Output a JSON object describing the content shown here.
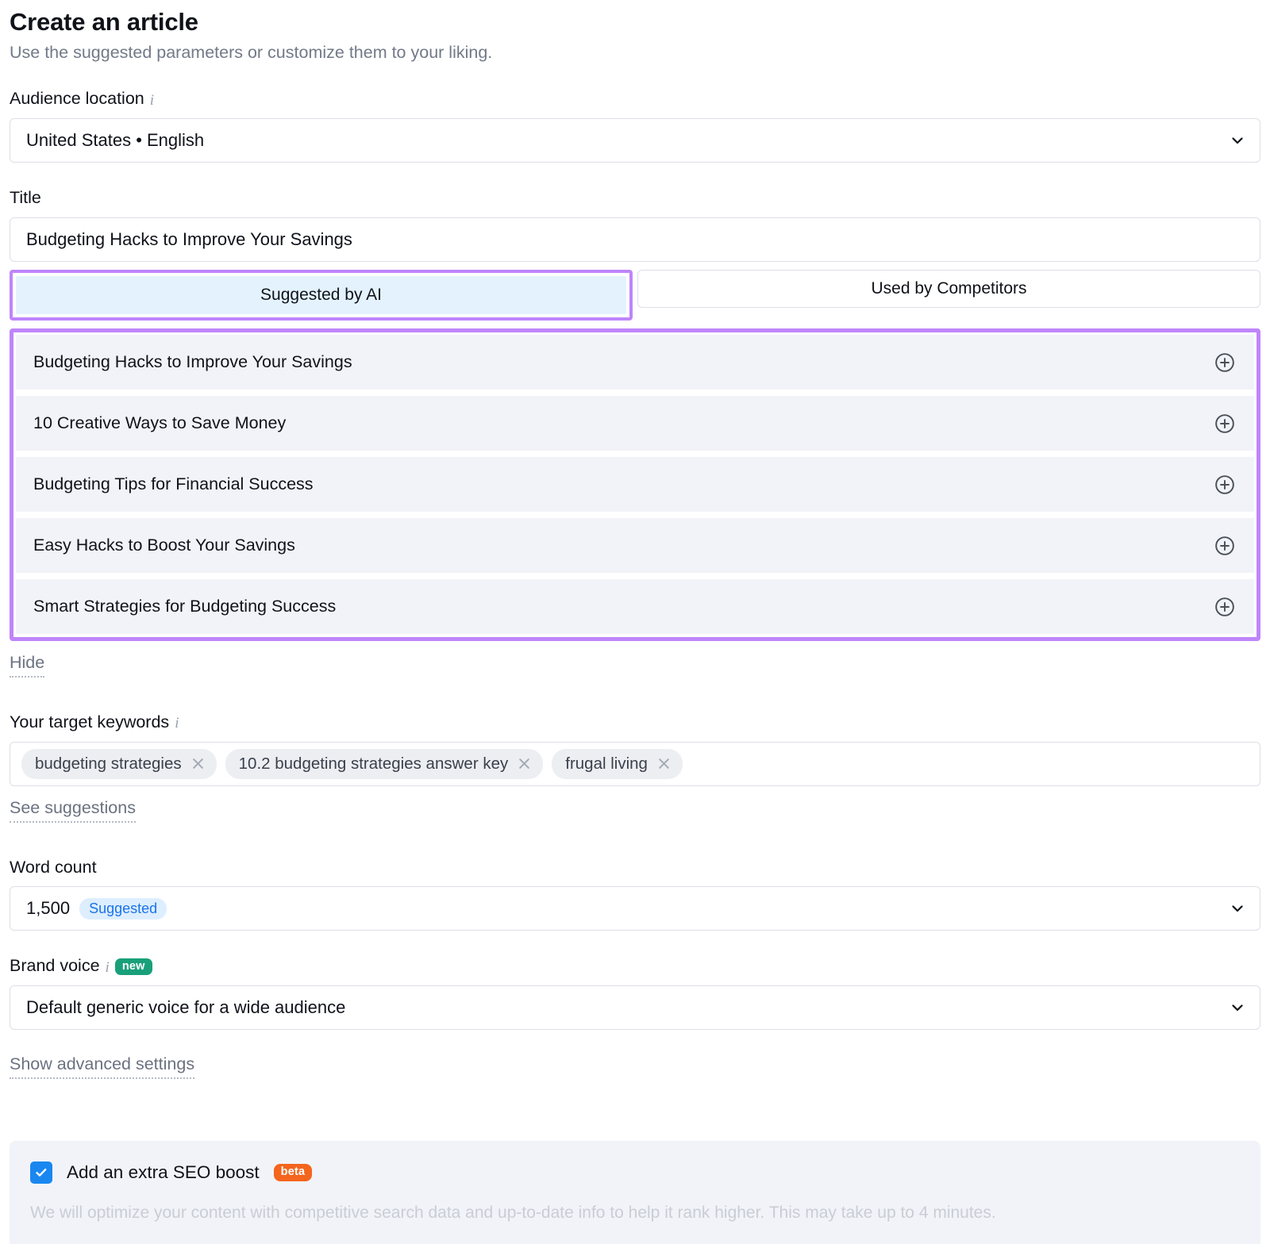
{
  "header": {
    "title": "Create an article",
    "subtitle": "Use the suggested parameters or customize them to your liking."
  },
  "audience_location": {
    "label": "Audience location",
    "info_icon": "info-icon",
    "value": "United States • English",
    "chevron_icon": "chevron-down-icon"
  },
  "title_field": {
    "label": "Title",
    "value": "Budgeting Hacks to Improve Your Savings"
  },
  "tabs": [
    {
      "label": "Suggested by AI",
      "active": true
    },
    {
      "label": "Used by Competitors",
      "active": false
    }
  ],
  "suggestions": [
    {
      "text": "Budgeting Hacks to Improve Your Savings",
      "add_icon": "plus-circle-icon"
    },
    {
      "text": "10 Creative Ways to Save Money",
      "add_icon": "plus-circle-icon"
    },
    {
      "text": "Budgeting Tips for Financial Success",
      "add_icon": "plus-circle-icon"
    },
    {
      "text": "Easy Hacks to Boost Your Savings",
      "add_icon": "plus-circle-icon"
    },
    {
      "text": "Smart Strategies for Budgeting Success",
      "add_icon": "plus-circle-icon"
    }
  ],
  "hide_link": "Hide",
  "target_keywords": {
    "label": "Your target keywords",
    "info_icon": "info-icon",
    "chips": [
      {
        "text": "budgeting strategies",
        "remove_icon": "close-icon"
      },
      {
        "text": "10.2 budgeting strategies answer key",
        "remove_icon": "close-icon"
      },
      {
        "text": "frugal living",
        "remove_icon": "close-icon"
      }
    ],
    "see_suggestions_link": "See suggestions"
  },
  "word_count": {
    "label": "Word count",
    "value": "1,500",
    "badge": "Suggested",
    "chevron_icon": "chevron-down-icon"
  },
  "brand_voice": {
    "label": "Brand voice",
    "info_icon": "info-icon",
    "badge": "new",
    "value": "Default generic voice for a wide audience",
    "chevron_icon": "chevron-down-icon"
  },
  "advanced_settings_link": "Show advanced settings",
  "seo_boost": {
    "checked": true,
    "label": "Add an extra SEO boost",
    "badge": "beta",
    "description": "We will optimize your content with competitive search data and up-to-date info to help it rank higher. This may take up to 4 minutes."
  },
  "colors": {
    "annotation_purple": "#bf85fb",
    "active_tab_bg": "#e3f2fd",
    "row_bg": "#f2f3f8",
    "badge_new_green": "#19a07a",
    "badge_beta_orange": "#f4651d",
    "checkbox_blue": "#1a87f0",
    "suggested_pill_blue": "#1a73e8"
  }
}
